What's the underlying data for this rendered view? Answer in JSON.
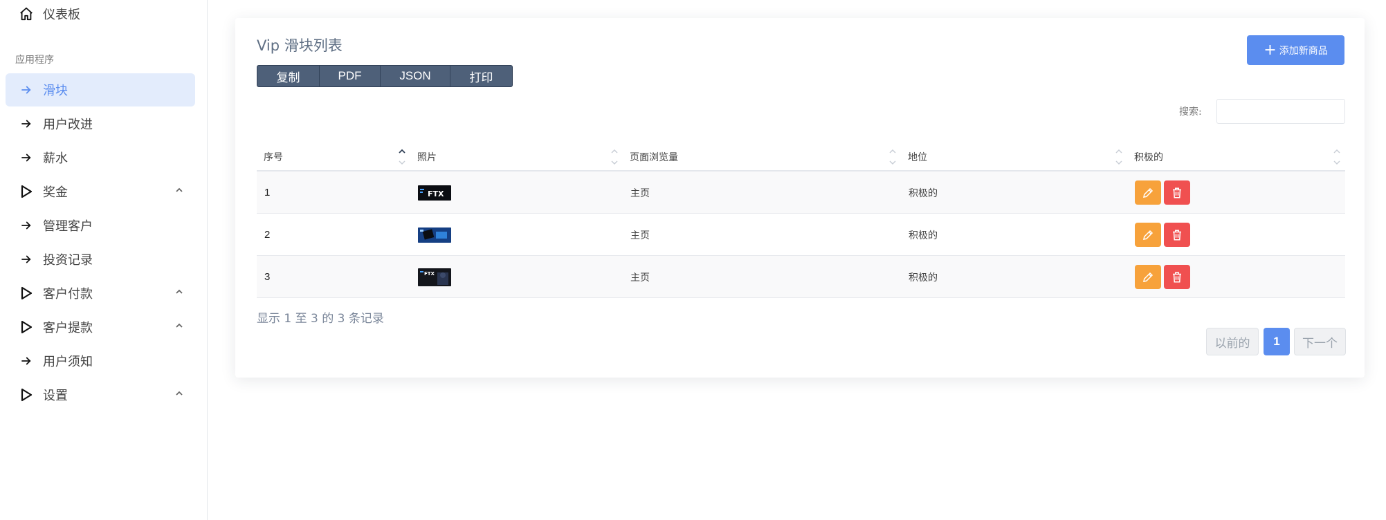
{
  "sidebar": {
    "dashboard": "仪表板",
    "section": "应用程序",
    "items": [
      {
        "label": "滑块",
        "icon": "arrow-right-icon"
      },
      {
        "label": "用户改进",
        "icon": "arrow-right-icon"
      },
      {
        "label": "薪水",
        "icon": "arrow-right-icon"
      },
      {
        "label": "奖金",
        "icon": "play-icon"
      },
      {
        "label": "管理客户",
        "icon": "arrow-right-icon"
      },
      {
        "label": "投资记录",
        "icon": "arrow-right-icon"
      },
      {
        "label": "客户付款",
        "icon": "play-icon"
      },
      {
        "label": "客户提款",
        "icon": "play-icon"
      },
      {
        "label": "用户须知",
        "icon": "arrow-right-icon"
      },
      {
        "label": "设置",
        "icon": "play-icon"
      }
    ]
  },
  "card": {
    "title": "Vip 滑块列表",
    "export_buttons": [
      "复制",
      "PDF",
      "JSON",
      "打印"
    ],
    "add_button": "添加新商品",
    "search_label": "搜索:",
    "search_value": ""
  },
  "table": {
    "headers": [
      "序号",
      "照片",
      "页面浏览量",
      "地位",
      "积极的"
    ],
    "rows": [
      {
        "id": "1",
        "page": "主页",
        "status": "积极的"
      },
      {
        "id": "2",
        "page": "主页",
        "status": "积极的"
      },
      {
        "id": "3",
        "page": "主页",
        "status": "积极的"
      }
    ]
  },
  "footer": {
    "info": "显示 1 至 3 的 3 条记录",
    "prev": "以前的",
    "current_page": "1",
    "next": "下一个"
  },
  "colors": {
    "accent": "#5b8def",
    "edit": "#f7a23b",
    "delete": "#f05050",
    "button_group": "#4e6079"
  }
}
